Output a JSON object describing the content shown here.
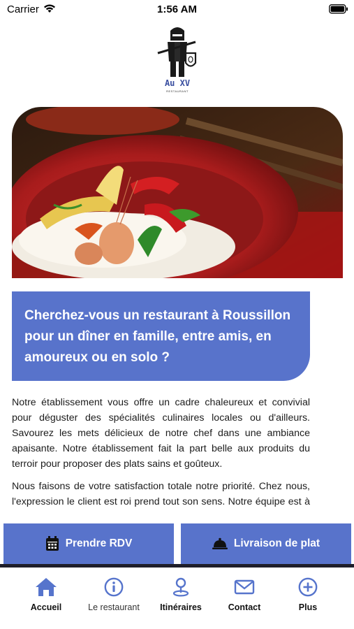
{
  "status_bar": {
    "carrier": "Carrier",
    "time": "1:56 AM"
  },
  "logo": {
    "text": "Au XV",
    "subtext": "RESTAURANT"
  },
  "hero": {
    "question": "Cherchez-vous un restaurant à Roussillon pour un dîner en famille, entre amis, en amoureux ou en solo ?"
  },
  "intro": {
    "paragraph1": "Notre établissement vous offre un cadre chaleureux et convivial pour déguster des spécialités culinaires locales ou d'ailleurs. Savourez les mets délicieux de notre chef dans une ambiance apaisante. Notre établissement fait la part belle aux produits du terroir pour proposer des plats sains et goûteux.",
    "paragraph2": "Nous faisons de votre satisfaction totale notre priorité. Chez nous, l'expression le client est roi prend tout son sens. Notre équipe est à votre écoute."
  },
  "actions": {
    "rdv_label": "Prendre RDV",
    "delivery_label": "Livraison de plat"
  },
  "tabs": [
    {
      "label": "Accueil",
      "icon": "home-icon",
      "active": true
    },
    {
      "label": "Le restaurant",
      "icon": "info-icon",
      "active": false
    },
    {
      "label": "Itinéraires",
      "icon": "location-pin-icon",
      "active": false
    },
    {
      "label": "Contact",
      "icon": "mail-icon",
      "active": false
    },
    {
      "label": "Plus",
      "icon": "plus-circle-icon",
      "active": false
    }
  ],
  "colors": {
    "accent": "#5873cb",
    "icon_blue": "#5674cc"
  }
}
